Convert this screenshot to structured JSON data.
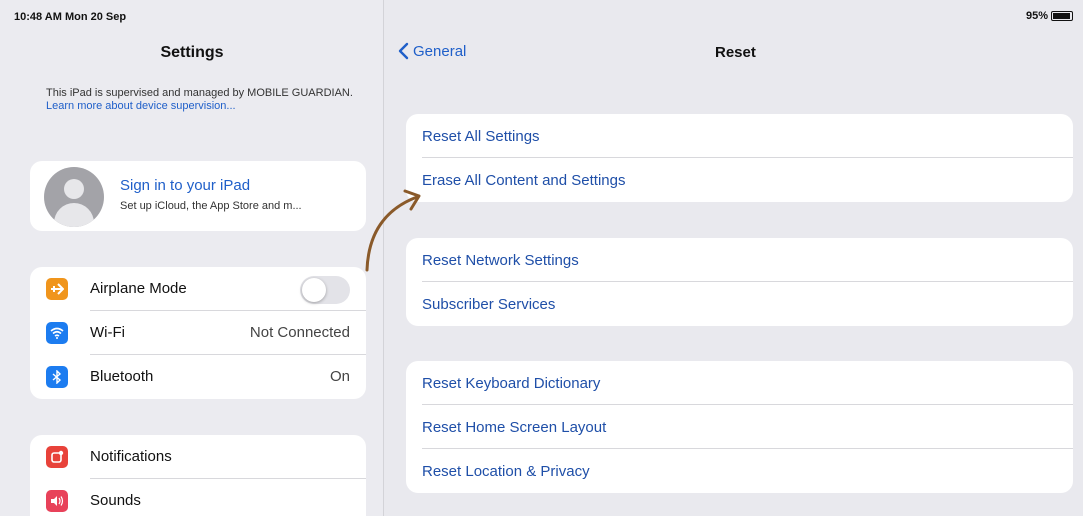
{
  "status_bar": {
    "time": "10:48 AM  Mon 20 Sep",
    "battery_percent": "95%"
  },
  "sidebar": {
    "title": "Settings",
    "supervision_text": "This iPad is supervised and managed by MOBILE GUARDIAN.",
    "supervision_link": "Learn more about device supervision...",
    "account": {
      "title": "Sign in to your iPad",
      "subtitle": "Set up iCloud, the App Store and m..."
    },
    "items": [
      {
        "label": "Airplane Mode",
        "icon": "airplane-icon",
        "color": "#f0951c",
        "toggle": false
      },
      {
        "label": "Wi-Fi",
        "icon": "wifi-icon",
        "color": "#1c7cf0",
        "value": "Not Connected"
      },
      {
        "label": "Bluetooth",
        "icon": "bluetooth-icon",
        "color": "#1c7cf0",
        "value": "On"
      },
      {
        "label": "Notifications",
        "icon": "notifications-icon",
        "color": "#e8423a"
      },
      {
        "label": "Sounds",
        "icon": "sounds-icon",
        "color": "#e8425a"
      }
    ]
  },
  "main": {
    "back_label": "General",
    "title": "Reset",
    "groups": [
      [
        "Reset All Settings",
        "Erase All Content and Settings"
      ],
      [
        "Reset Network Settings",
        "Subscriber Services"
      ],
      [
        "Reset Keyboard Dictionary",
        "Reset Home Screen Layout",
        "Reset Location & Privacy"
      ]
    ]
  }
}
